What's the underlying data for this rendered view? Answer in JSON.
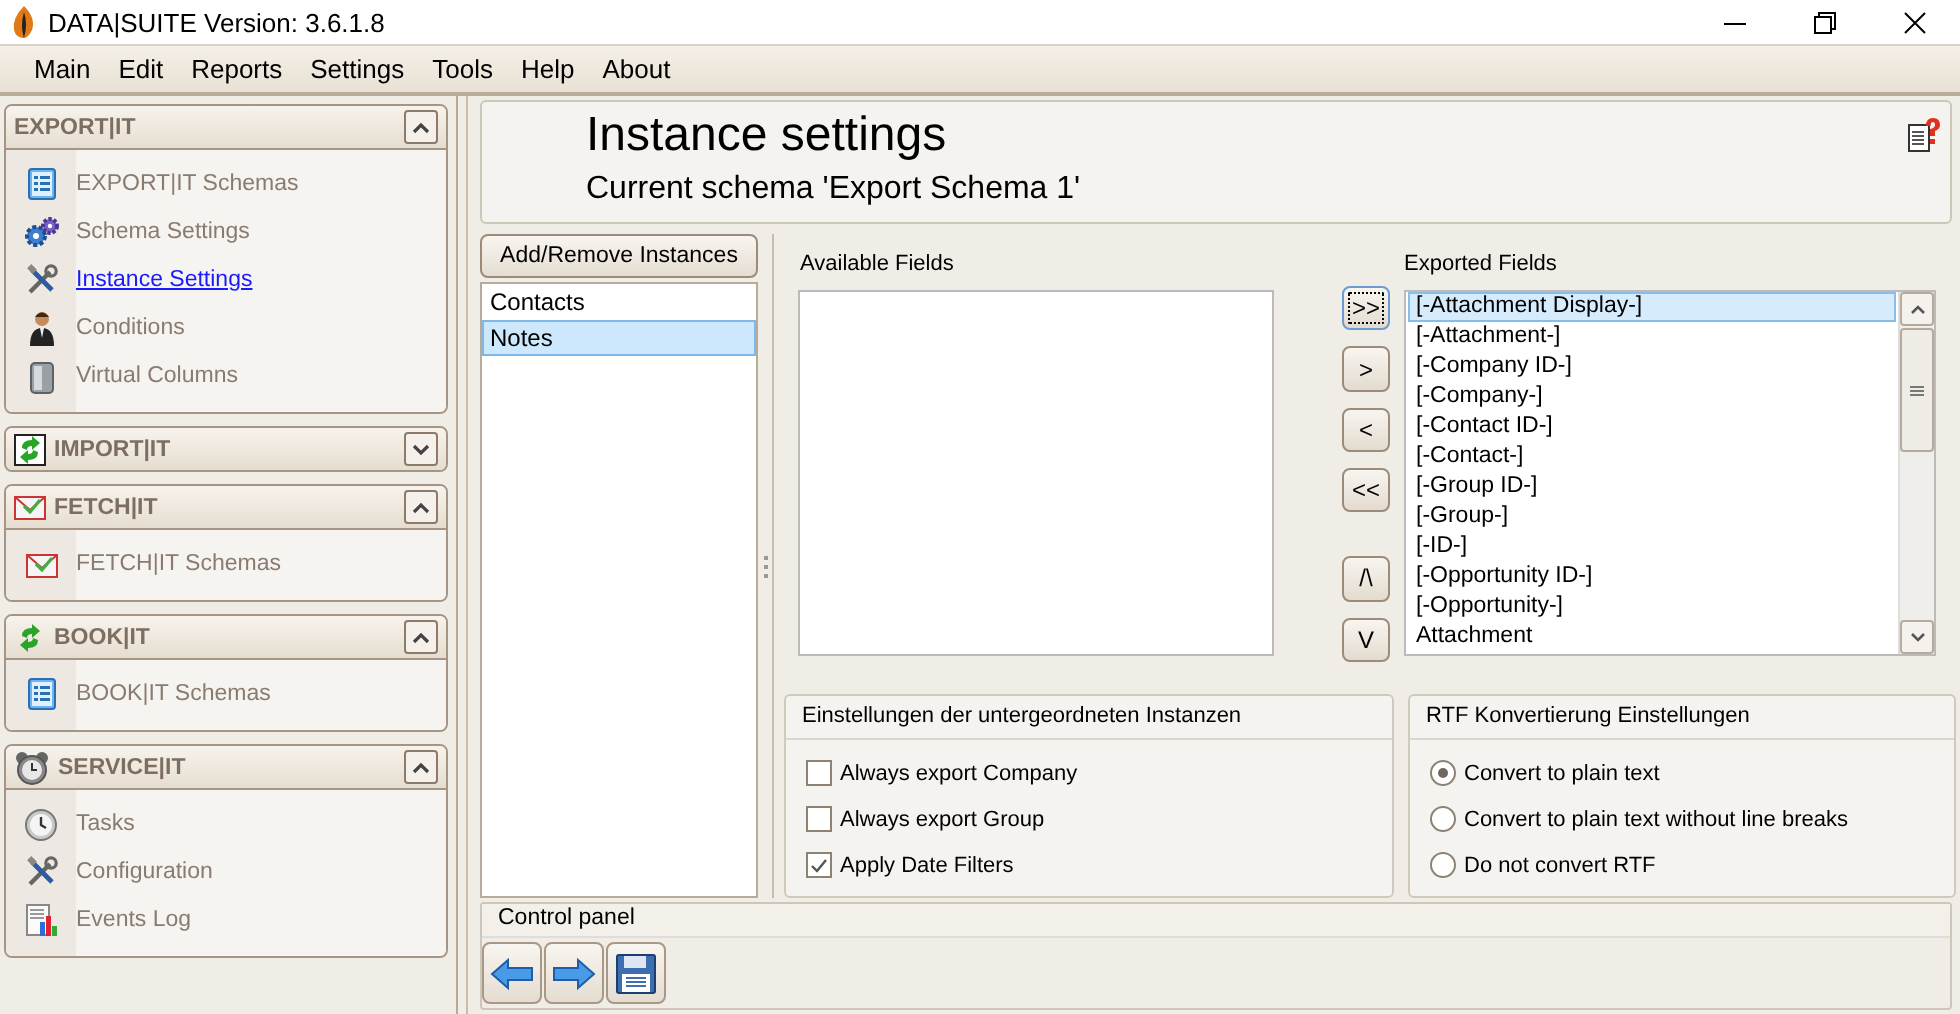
{
  "window": {
    "title": "DATA|SUITE Version: 3.6.1.8"
  },
  "menu": [
    "Main",
    "Edit",
    "Reports",
    "Settings",
    "Tools",
    "Help",
    "About"
  ],
  "sidebar": {
    "sections": [
      {
        "title": "EXPORT|IT",
        "expanded": true,
        "items": [
          {
            "label": "EXPORT|IT Schemas",
            "selected": false
          },
          {
            "label": "Schema Settings",
            "selected": false
          },
          {
            "label": "Instance Settings",
            "selected": true
          },
          {
            "label": "Conditions",
            "selected": false
          },
          {
            "label": "Virtual Columns",
            "selected": false
          }
        ]
      },
      {
        "title": "IMPORT|IT",
        "expanded": false
      },
      {
        "title": "FETCH|IT",
        "expanded": true,
        "items": [
          {
            "label": "FETCH|IT Schemas",
            "selected": false
          }
        ]
      },
      {
        "title": "BOOK|IT",
        "expanded": true,
        "items": [
          {
            "label": "BOOK|IT Schemas",
            "selected": false
          }
        ]
      },
      {
        "title": "SERVICE|IT",
        "expanded": true,
        "items": [
          {
            "label": "Tasks",
            "selected": false
          },
          {
            "label": "Configuration",
            "selected": false
          },
          {
            "label": "Events Log",
            "selected": false
          }
        ]
      }
    ]
  },
  "page": {
    "title": "Instance settings",
    "subtitle": "Current schema 'Export Schema 1'"
  },
  "instances": {
    "button": "Add/Remove Instances",
    "items": [
      {
        "label": "Contacts",
        "selected": false
      },
      {
        "label": "Notes",
        "selected": true
      }
    ]
  },
  "available_fields": {
    "label": "Available Fields"
  },
  "move_buttons": [
    ">>",
    ">",
    "<",
    "<<",
    "/\\",
    "V"
  ],
  "exported_fields": {
    "label": "Exported Fields",
    "items": [
      {
        "label": "[-Attachment Display-]",
        "selected": true
      },
      {
        "label": "[-Attachment-]",
        "selected": false
      },
      {
        "label": "[-Company ID-]",
        "selected": false
      },
      {
        "label": "[-Company-]",
        "selected": false
      },
      {
        "label": "[-Contact ID-]",
        "selected": false
      },
      {
        "label": "[-Contact-]",
        "selected": false
      },
      {
        "label": "[-Group ID-]",
        "selected": false
      },
      {
        "label": "[-Group-]",
        "selected": false
      },
      {
        "label": "[-ID-]",
        "selected": false
      },
      {
        "label": "[-Opportunity ID-]",
        "selected": false
      },
      {
        "label": "[-Opportunity-]",
        "selected": false
      },
      {
        "label": "Attachment",
        "selected": false
      }
    ]
  },
  "sub_instances": {
    "title": "Einstellungen der untergeordneten Instanzen",
    "options": [
      {
        "label": "Always export Company",
        "checked": false
      },
      {
        "label": "Always export Group",
        "checked": false
      },
      {
        "label": "Apply Date Filters",
        "checked": true
      }
    ]
  },
  "rtf": {
    "title": "RTF Konvertierung Einstellungen",
    "options": [
      {
        "label": "Convert to plain text",
        "selected": true
      },
      {
        "label": "Convert to plain text without line breaks",
        "selected": false
      },
      {
        "label": "Do not convert RTF",
        "selected": false
      }
    ]
  },
  "control_panel": {
    "title": "Control panel"
  }
}
